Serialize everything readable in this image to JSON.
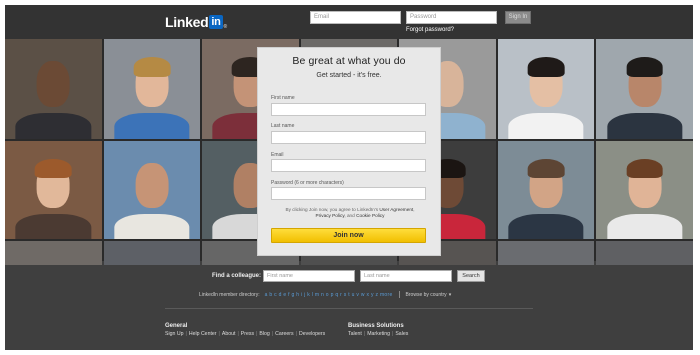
{
  "header": {
    "logo_text": "Linked",
    "logo_in": "in",
    "logo_mark": "®",
    "email_placeholder": "Email",
    "password_placeholder": "Password",
    "signin_label": "Sign In",
    "forgot_label": "Forgot password?"
  },
  "signup": {
    "headline": "Be great at what you do",
    "subhead": "Get started - it's free.",
    "first_name_label": "First name",
    "last_name_label": "Last name",
    "email_label": "Email",
    "password_label": "Password (6 or more characters)",
    "terms_prefix": "By clicking Join now, you agree to LinkedIn's ",
    "user_agreement": "User Agreement",
    "terms_mid": ",",
    "privacy_policy": "Privacy Policy",
    "terms_and": ", and ",
    "cookie_policy": "Cookie Policy",
    "join_label": "Join now"
  },
  "colleague": {
    "label": "Find a colleague:",
    "first_placeholder": "First name",
    "last_placeholder": "Last name",
    "search_label": "Search"
  },
  "directory": {
    "label": "LinkedIn member directory:",
    "letters": "a b c d e f g h i j k l m n o p q r s t u v w x y z more",
    "browse_label": "Browse by country"
  },
  "footer": {
    "general_title": "General",
    "general_links": [
      "Sign Up",
      "Help Center",
      "About",
      "Press",
      "Blog",
      "Careers",
      "Developers"
    ],
    "business_title": "Business Solutions",
    "business_links": [
      "Talent",
      "Marketing",
      "Sales"
    ]
  },
  "colors": {
    "brand_blue": "#0a66c2",
    "join_yellow": "#f5c900",
    "page_dark": "#3f3f3f"
  }
}
